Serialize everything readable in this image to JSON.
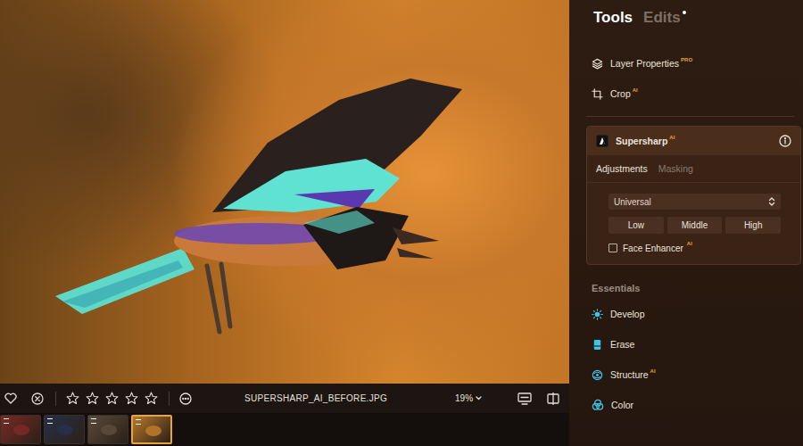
{
  "header": {
    "tabs": [
      {
        "label": "Tools",
        "selected": true,
        "modified": false
      },
      {
        "label": "Edits",
        "selected": false,
        "modified": true
      }
    ]
  },
  "tools": [
    {
      "label": "Layer Properties",
      "badge": "PRO"
    },
    {
      "label": "Crop",
      "badge": "AI"
    }
  ],
  "supersharp": {
    "title": "Supersharp",
    "badge": "AI",
    "expanded": true,
    "subtabs": [
      {
        "label": "Adjustments",
        "selected": true
      },
      {
        "label": "Masking",
        "selected": false
      }
    ],
    "mode": "Universal",
    "levels": [
      {
        "label": "Low",
        "selected": false
      },
      {
        "label": "Middle",
        "selected": false
      },
      {
        "label": "High",
        "selected": false
      }
    ],
    "face_enhancer": {
      "label": "Face Enhancer",
      "badge": "AI",
      "checked": false
    }
  },
  "essentials": {
    "title": "Essentials",
    "items": [
      {
        "label": "Develop"
      },
      {
        "label": "Erase"
      },
      {
        "label": "Structure",
        "badge": "AI"
      },
      {
        "label": "Color"
      }
    ]
  },
  "toolbar": {
    "liked": false,
    "rejected": false,
    "stars": 0,
    "filename": "SUPERSHARP_AI_BEFORE.JPG",
    "zoom": "19%"
  },
  "filmstrip": [
    {
      "selected": false,
      "color": "#7a2a24"
    },
    {
      "selected": false,
      "color": "#283048"
    },
    {
      "selected": false,
      "color": "#5a4a3a"
    },
    {
      "selected": true,
      "color": "#b8782a"
    }
  ]
}
